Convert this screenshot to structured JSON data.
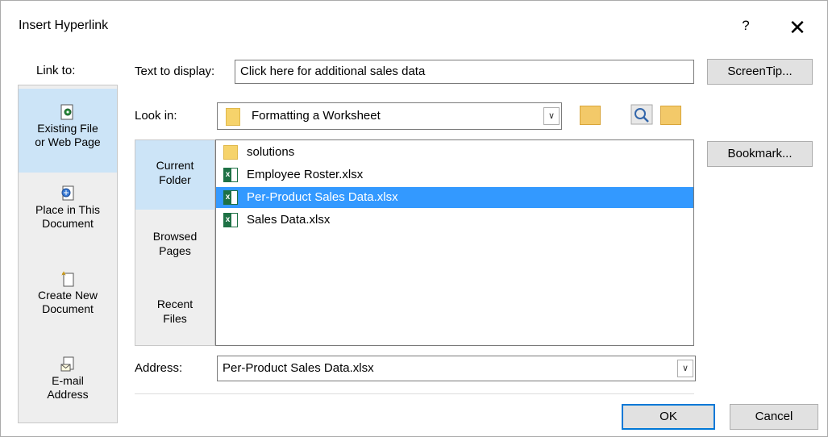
{
  "dialog": {
    "title": "Insert Hyperlink",
    "help_label": "?",
    "close_label": "✕"
  },
  "link_to": {
    "label": "Link to:",
    "items": [
      {
        "line1": "Existing File",
        "line2": "or Web Page",
        "selected": true
      },
      {
        "line1": "Place in This",
        "line2": "Document",
        "selected": false
      },
      {
        "line1": "Create New",
        "line2": "Document",
        "selected": false
      },
      {
        "line1": "E-mail",
        "line2": "Address",
        "selected": false
      }
    ]
  },
  "text_to_display": {
    "label": "Text to display:",
    "value": "Click here for additional sales data"
  },
  "screentip_button": "ScreenTip...",
  "look_in": {
    "label": "Look in:",
    "value": "Formatting a Worksheet"
  },
  "nav": {
    "items": [
      {
        "line1": "Current",
        "line2": "Folder",
        "selected": true
      },
      {
        "line1": "Browsed",
        "line2": "Pages",
        "selected": false
      },
      {
        "line1": "Recent",
        "line2": "Files",
        "selected": false
      }
    ]
  },
  "files": [
    {
      "name": "solutions",
      "type": "folder",
      "selected": false
    },
    {
      "name": "Employee Roster.xlsx",
      "type": "excel",
      "selected": false
    },
    {
      "name": "Per-Product Sales Data.xlsx",
      "type": "excel",
      "selected": true
    },
    {
      "name": "Sales Data.xlsx",
      "type": "excel",
      "selected": false
    }
  ],
  "bookmark_button": "Bookmark...",
  "address": {
    "label": "Address:",
    "value": "Per-Product Sales Data.xlsx"
  },
  "ok_button": "OK",
  "cancel_button": "Cancel",
  "colors": {
    "selection_blue": "#3399ff",
    "panel_selected": "#cce4f7",
    "default_button_border": "#0078d7"
  }
}
